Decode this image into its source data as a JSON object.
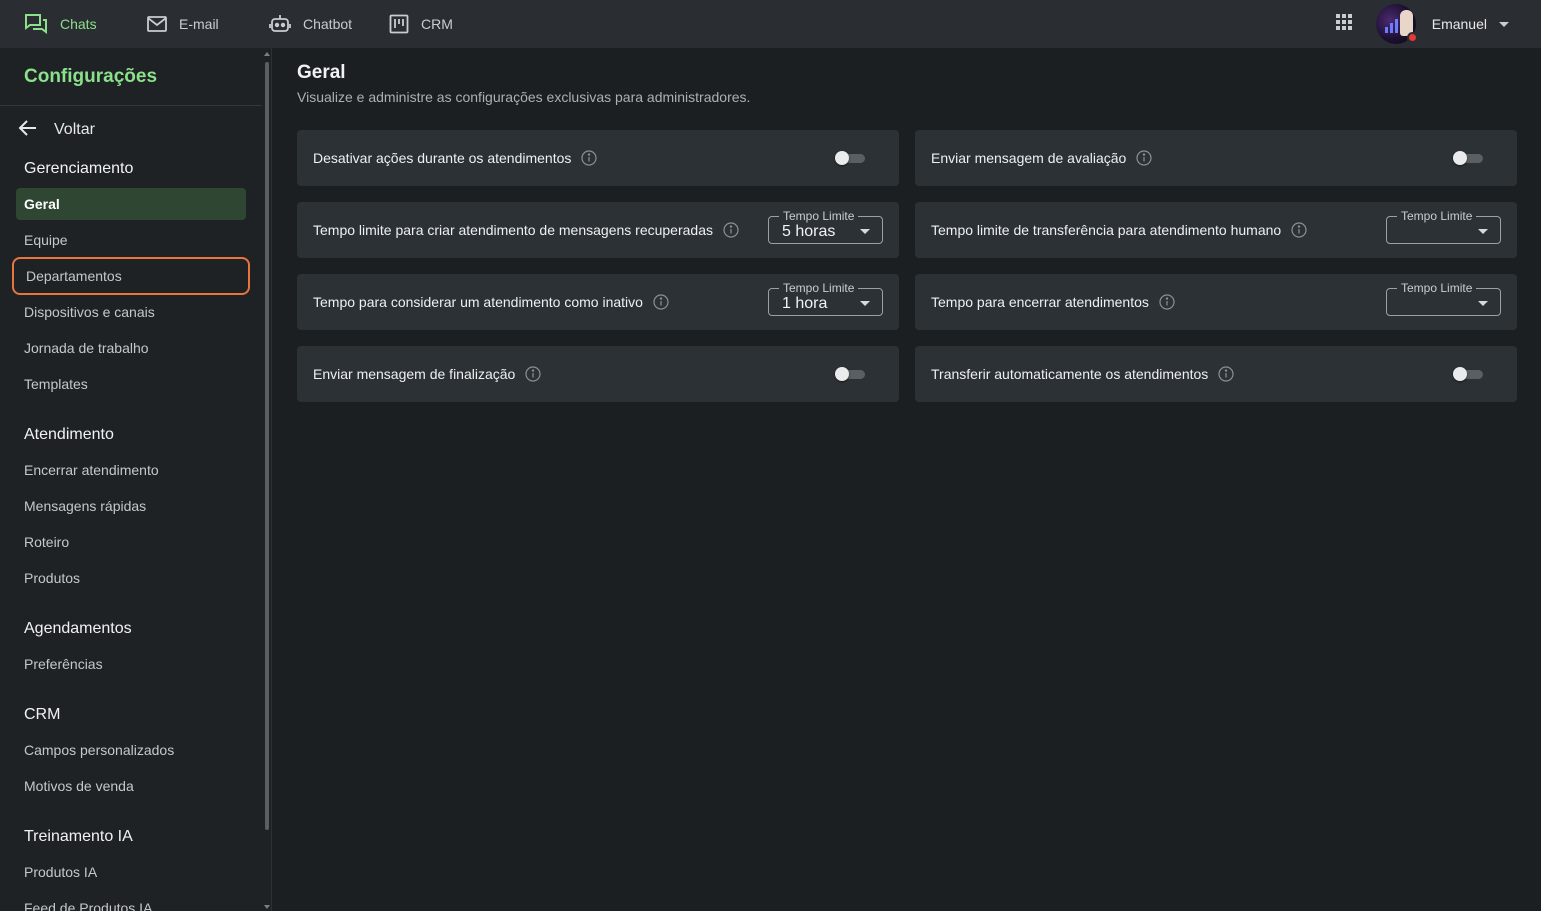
{
  "topnav": {
    "items": [
      {
        "label": "Chats",
        "icon": "chat-icon",
        "active": true
      },
      {
        "label": "E-mail",
        "icon": "email-icon",
        "active": false
      },
      {
        "label": "Chatbot",
        "icon": "robot-icon",
        "active": false
      },
      {
        "label": "CRM",
        "icon": "kanban-icon",
        "active": false
      }
    ],
    "apps_icon": "apps-grid-icon",
    "user_name": "Emanuel"
  },
  "sidebar": {
    "title": "Configurações",
    "back_label": "Voltar",
    "sections": [
      {
        "heading": "Gerenciamento",
        "items": [
          "Geral",
          "Equipe",
          "Departamentos",
          "Dispositivos e canais",
          "Jornada de trabalho",
          "Templates"
        ]
      },
      {
        "heading": "Atendimento",
        "items": [
          "Encerrar atendimento",
          "Mensagens rápidas",
          "Roteiro",
          "Produtos"
        ]
      },
      {
        "heading": "Agendamentos",
        "items": [
          "Preferências"
        ]
      },
      {
        "heading": "CRM",
        "items": [
          "Campos personalizados",
          "Motivos de venda"
        ]
      },
      {
        "heading": "Treinamento IA",
        "items": [
          "Produtos IA",
          "Feed de Produtos IA"
        ]
      }
    ],
    "active_item": "Geral",
    "focused_item": "Departamentos"
  },
  "main": {
    "title": "Geral",
    "subtitle": "Visualize e administre as configurações exclusivas para administradores.",
    "settings": [
      {
        "label": "Desativar ações durante os atendimentos",
        "control": "toggle",
        "enabled": false
      },
      {
        "label": "Enviar mensagem de avaliação",
        "control": "toggle",
        "enabled": false
      },
      {
        "label": "Tempo limite para criar atendimento de mensagens recuperadas",
        "control": "select",
        "legend": "Tempo Limite",
        "value": "5 horas"
      },
      {
        "label": "Tempo limite de transferência para atendimento humano",
        "control": "select",
        "legend": "Tempo Limite",
        "value": ""
      },
      {
        "label": "Tempo para considerar um atendimento como inativo",
        "control": "select",
        "legend": "Tempo Limite",
        "value": "1 hora"
      },
      {
        "label": "Tempo para encerrar atendimentos",
        "control": "select",
        "legend": "Tempo Limite",
        "value": ""
      },
      {
        "label": "Enviar mensagem de finalização",
        "control": "toggle",
        "enabled": false
      },
      {
        "label": "Transferir automaticamente os atendimentos",
        "control": "toggle",
        "enabled": false
      }
    ]
  },
  "colors": {
    "accent": "#8be08b",
    "active_bg": "#2e4632",
    "focus_ring": "#e8743e",
    "card_bg": "#2c3135",
    "page_bg": "#1c1f22",
    "status_busy": "#e53935"
  }
}
